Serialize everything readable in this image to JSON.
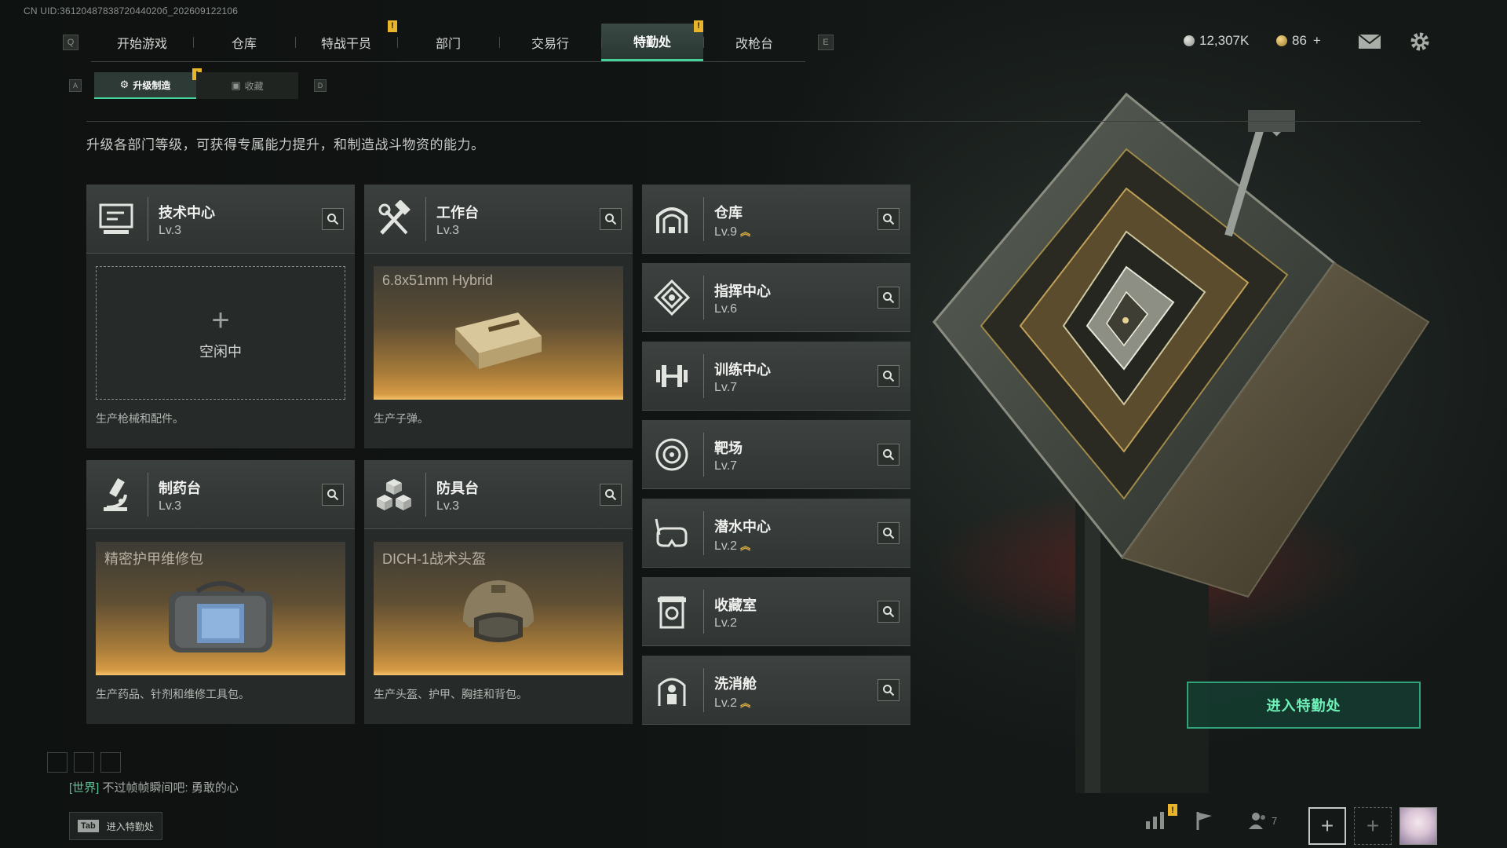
{
  "uid": "CN UID:3612048783872044020б_202609122106",
  "nav": {
    "left_key": "Q",
    "right_key": "E",
    "tabs": [
      {
        "label": "开始游戏"
      },
      {
        "label": "仓库"
      },
      {
        "label": "特战干员"
      },
      {
        "label": "部门"
      },
      {
        "label": "交易行"
      },
      {
        "label": "特勤处"
      },
      {
        "label": "改枪台"
      }
    ],
    "active_tab": "特勤处"
  },
  "currency": {
    "coins": "12,307K",
    "premium": "86",
    "premium_add": "+"
  },
  "subnav": {
    "left_key": "A",
    "right_key": "D",
    "tabs": [
      {
        "label": "升级制造"
      },
      {
        "label": "收藏"
      }
    ]
  },
  "badge_mark": "!",
  "description": "升级各部门等级，可获得专属能力提升，和制造战斗物资的能力。",
  "cards": [
    {
      "name": "技术中心",
      "level": "Lv.3",
      "status": "空闲中",
      "footer": "生产枪械和配件。"
    },
    {
      "name": "工作台",
      "level": "Lv.3",
      "product": "6.8x51mm Hybrid",
      "footer": "生产子弹。"
    },
    {
      "name": "制药台",
      "level": "Lv.3",
      "product": "精密护甲维修包",
      "footer": "生产药品、针剂和维修工具包。"
    },
    {
      "name": "防具台",
      "level": "Lv.3",
      "product": "DICH-1战术头盔",
      "footer": "生产头盔、护甲、胸挂和背包。"
    }
  ],
  "departments": [
    {
      "name": "仓库",
      "level": "Lv.9",
      "upgrade": true
    },
    {
      "name": "指挥中心",
      "level": "Lv.6",
      "upgrade": false
    },
    {
      "name": "训练中心",
      "level": "Lv.7",
      "upgrade": false
    },
    {
      "name": "靶场",
      "level": "Lv.7",
      "upgrade": false
    },
    {
      "name": "潜水中心",
      "level": "Lv.2",
      "upgrade": true
    },
    {
      "name": "收藏室",
      "level": "Lv.2",
      "upgrade": false
    },
    {
      "name": "洗消舱",
      "level": "Lv.2",
      "upgrade": true
    }
  ],
  "enter_button": "进入特勤处",
  "chat": {
    "channel": "[世界]",
    "message": "不过帧帧瞬间吧: 勇敢的心"
  },
  "tab_hint": {
    "key": "Tab",
    "label": "进入特勤处"
  },
  "social": {
    "friends_count": "7"
  },
  "colors": {
    "accent": "#46d39b",
    "badge": "#e8b52a",
    "upgrade": "#e2b540"
  }
}
